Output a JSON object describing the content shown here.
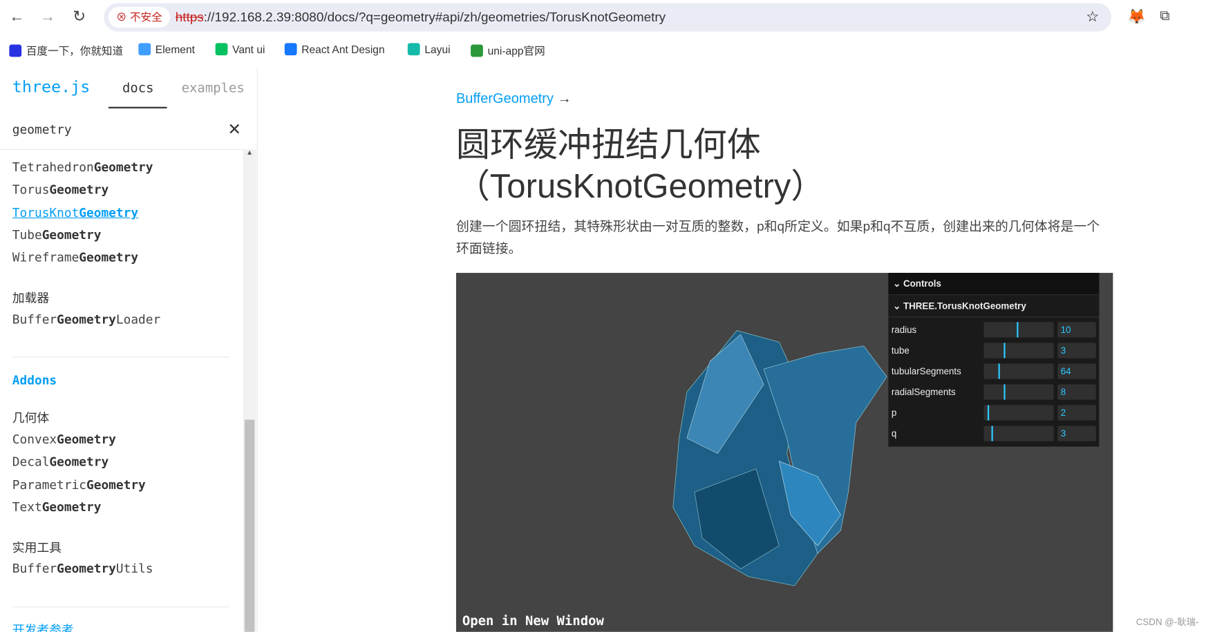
{
  "browser": {
    "insecure_label": "不安全",
    "url_scheme": "https",
    "url_rest": "://192.168.2.39:8080/docs/?q=geometry#api/zh/geometries/TorusKnotGeometry",
    "bookmarks": [
      {
        "label": "百度一下，你就知道",
        "color": "#2932e1"
      },
      {
        "label": "Element",
        "color": "#409eff"
      },
      {
        "label": "Vant ui",
        "color": "#07c160"
      },
      {
        "label": "React Ant Design",
        "color": "#1677ff"
      },
      {
        "label": "Layui",
        "color": "#16baaa"
      },
      {
        "label": "uni-app官网",
        "color": "#2b9939"
      }
    ]
  },
  "sidebar": {
    "logo": "three.js",
    "tabs": [
      "docs",
      "examples"
    ],
    "search_value": "geometry",
    "items": [
      {
        "pre": "Tetrahedron",
        "bold": "Geometry",
        "post": ""
      },
      {
        "pre": "Torus",
        "bold": "Geometry",
        "post": ""
      },
      {
        "pre": "TorusKnot",
        "bold": "Geometry",
        "post": "",
        "active": true
      },
      {
        "pre": "Tube",
        "bold": "Geometry",
        "post": ""
      },
      {
        "pre": "Wireframe",
        "bold": "Geometry",
        "post": ""
      }
    ],
    "loaders_title": "加载器",
    "loader_item": {
      "pre": "Buffer",
      "bold": "Geometry",
      "post": "Loader"
    },
    "addons_title": "Addons",
    "addon_geom_title": "几何体",
    "addon_items": [
      {
        "pre": "Convex",
        "bold": "Geometry"
      },
      {
        "pre": "Decal",
        "bold": "Geometry"
      },
      {
        "pre": "Parametric",
        "bold": "Geometry"
      },
      {
        "pre": "Text",
        "bold": "Geometry"
      }
    ],
    "utils_title": "实用工具",
    "util_item": {
      "pre": "Buffer",
      "bold": "Geometry",
      "post": "Utils"
    },
    "dev_ref": "开发者参考"
  },
  "content": {
    "parent_link": "BufferGeometry",
    "parent_arrow": "→",
    "title_cn": "圆环缓冲扭结几何体",
    "title_en": "（TorusKnotGeometry）",
    "description": "创建一个圆环扭结，其特殊形状由一对互质的整数，p和q所定义。如果p和q不互质，创建出来的几何体将是一个环面链接。",
    "open_new_window": "Open in New Window"
  },
  "gui": {
    "controls": "Controls",
    "folder": "THREE.TorusKnotGeometry",
    "accent": "#2cc9ff",
    "params": [
      {
        "label": "radius",
        "value": "10",
        "fraction": 0.47
      },
      {
        "label": "tube",
        "value": "3",
        "fraction": 0.29
      },
      {
        "label": "tubularSegments",
        "value": "64",
        "fraction": 0.21
      },
      {
        "label": "radialSegments",
        "value": "8",
        "fraction": 0.29
      },
      {
        "label": "p",
        "value": "2",
        "fraction": 0.06
      },
      {
        "label": "q",
        "value": "3",
        "fraction": 0.11
      }
    ]
  },
  "watermark": "CSDN @-耿瑞-"
}
